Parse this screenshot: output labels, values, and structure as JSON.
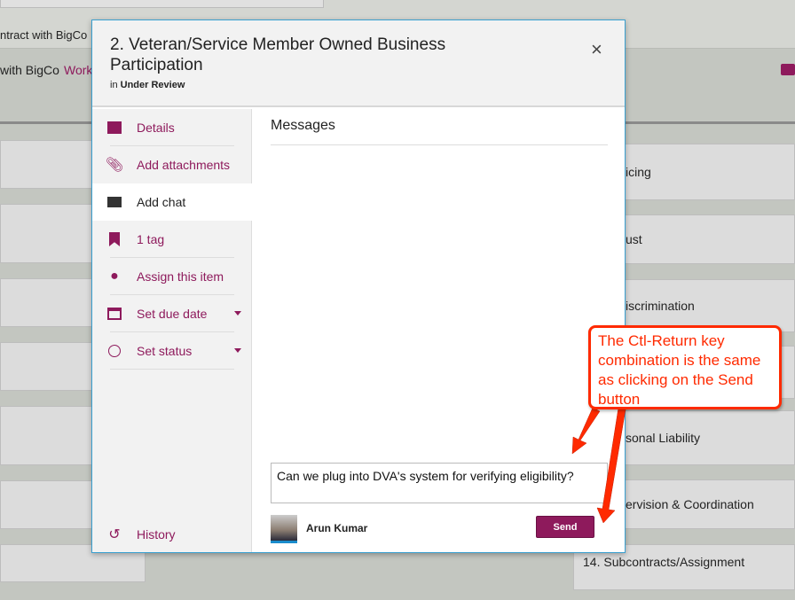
{
  "background": {
    "header_line1": "ntract with BigCo",
    "header_line2": "with BigCo",
    "header_link": "Work",
    "cards": [
      "icing",
      "ust",
      "iscrimination",
      "sonal Liability",
      "ervision & Coordination",
      "14. Subcontracts/Assignment"
    ]
  },
  "modal": {
    "title": "2. Veteran/Service Member Owned Business Participation",
    "in_label": "in",
    "status": "Under Review",
    "close": "×",
    "sidebar": [
      {
        "label": "Details",
        "icon": "details-icon"
      },
      {
        "label": "Add attachments",
        "icon": "paperclip-icon"
      },
      {
        "label": "Add chat",
        "icon": "chat-icon"
      },
      {
        "label": "1 tag",
        "icon": "bookmark-icon"
      },
      {
        "label": "Assign this item",
        "icon": "person-icon"
      },
      {
        "label": "Set due date",
        "icon": "calendar-icon"
      },
      {
        "label": "Set status",
        "icon": "circle-icon"
      }
    ],
    "history": "History",
    "messages_title": "Messages",
    "message_input": "Can we plug into DVA's system for verifying eligibility?",
    "user": "Arun Kumar",
    "send": "Send"
  },
  "callout": "The Ctl-Return key combination is the same as clicking on the Send button",
  "colors": {
    "accent": "#8e1a5c",
    "callout": "#ff2a00"
  }
}
